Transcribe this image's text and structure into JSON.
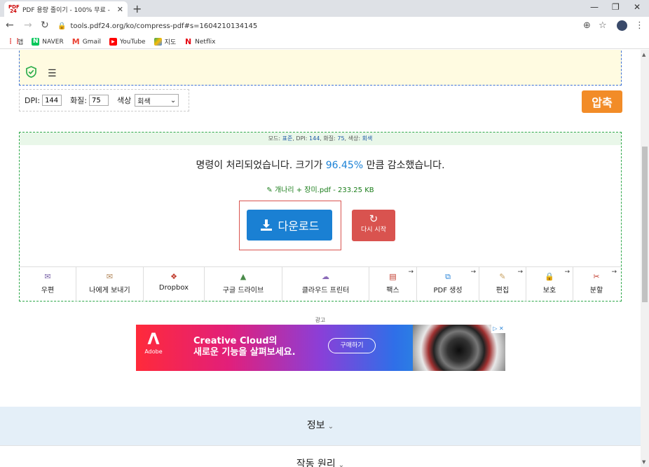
{
  "browser": {
    "tab_title": "PDF 용량 줄이기 - 100% 무료 -",
    "tab_favicon_text": "PDF 24",
    "url": "tools.pdf24.org/ko/compress-pdf#s=1604210134145",
    "bookmarks": [
      {
        "label": "앱",
        "icon": "apps-grid-icon",
        "color": "#e53935"
      },
      {
        "label": "NAVER",
        "icon": "naver-icon",
        "color": "#03c75a"
      },
      {
        "label": "Gmail",
        "icon": "gmail-icon",
        "color": "#ea4335"
      },
      {
        "label": "YouTube",
        "icon": "youtube-icon",
        "color": "#ff0000"
      },
      {
        "label": "지도",
        "icon": "maps-icon",
        "color": "#34a853"
      },
      {
        "label": "Netflix",
        "icon": "netflix-icon",
        "color": "#e50914"
      }
    ]
  },
  "options": {
    "dpi_label": "DPI:",
    "dpi_value": "144",
    "quality_label": "화질:",
    "quality_value": "75",
    "color_label": "색상",
    "color_value": "회색",
    "compress_button": "압축"
  },
  "result": {
    "mode_prefix": "모드:",
    "mode_value": "표준",
    "dpi_prefix": ", DPI:",
    "dpi_value": "144",
    "quality_prefix": ", 화질:",
    "quality_value": "75",
    "color_prefix": ", 색상:",
    "color_value": "회색",
    "message_before": "명령이 처리되었습니다. 크기가 ",
    "message_percent": "96.45%",
    "message_after": " 만큼 감소했습니다.",
    "file_label": "개나리 + 장미.pdf - 233.25 KB",
    "download_button": "다운로드",
    "restart_button": "다시 시작"
  },
  "actions": [
    {
      "label": "우편",
      "icon": "envelope-icon",
      "width": 81,
      "arrow": false
    },
    {
      "label": "나에게 보내기",
      "icon": "envelope-icon",
      "width": 96,
      "arrow": false
    },
    {
      "label": "Dropbox",
      "icon": "dropbox-icon",
      "width": 87,
      "arrow": false
    },
    {
      "label": "구글 드라이브",
      "icon": "google-drive-icon",
      "width": 111,
      "arrow": false
    },
    {
      "label": "클라우드 프린터",
      "icon": "cloud-printer-icon",
      "width": 124,
      "arrow": false
    },
    {
      "label": "팩스",
      "icon": "fax-icon",
      "width": 68,
      "arrow": true
    },
    {
      "label": "PDF 생성",
      "icon": "pdf-create-icon",
      "width": 89,
      "arrow": true
    },
    {
      "label": "편집",
      "icon": "pencil-icon",
      "width": 67,
      "arrow": true
    },
    {
      "label": "보호",
      "icon": "lock-icon",
      "width": 67,
      "arrow": true
    },
    {
      "label": "분할",
      "icon": "scissors-icon",
      "width": 68,
      "arrow": true
    }
  ],
  "ad": {
    "label": "광고",
    "brand": "Adobe",
    "headline_line1": "Creative Cloud의",
    "headline_line2": "새로운 기능을 살펴보세요.",
    "cta": "구매하기",
    "badge": "▷ ✕"
  },
  "sections": {
    "info": "정보",
    "how_it_works": "작동 원리"
  },
  "colors": {
    "accent_blue": "#1a80d3",
    "compress_orange": "#f28c28",
    "restart_red": "#d9534f",
    "success_green": "#2ea84a"
  }
}
